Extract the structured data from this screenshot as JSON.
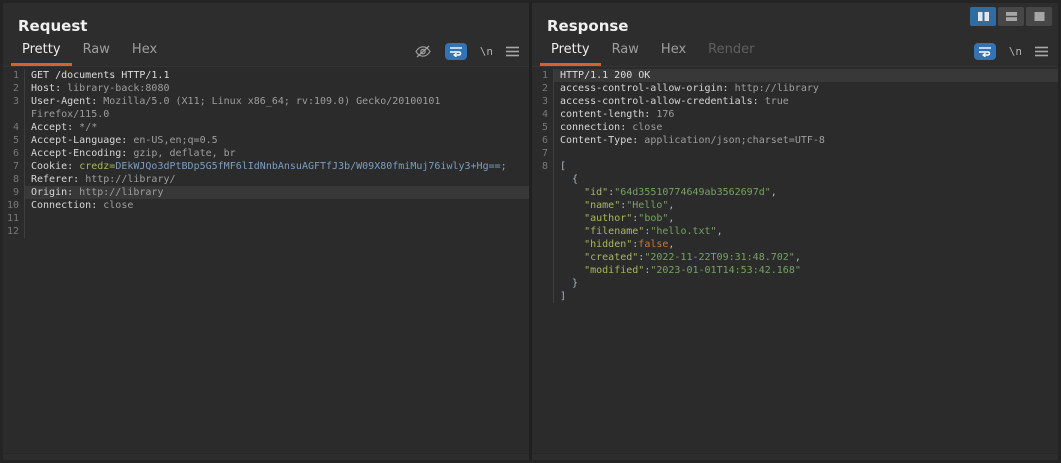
{
  "toolbar": {
    "layout_buttons": [
      {
        "name": "layout-side-by-side",
        "active": true
      },
      {
        "name": "layout-stacked",
        "active": false
      },
      {
        "name": "layout-single",
        "active": false
      }
    ],
    "active_color": "#2e6da4"
  },
  "accent_color": "#d8622b",
  "request": {
    "title": "Request",
    "tabs": [
      {
        "label": "Pretty",
        "state": "selected"
      },
      {
        "label": "Raw",
        "state": ""
      },
      {
        "label": "Hex",
        "state": ""
      }
    ],
    "icons": {
      "hide_icon": "hide-nonprintable-eye",
      "wrap_icon": "word-wrap",
      "newline_label": "\\n",
      "menu_icon": "menu"
    },
    "lines": [
      {
        "n": "1",
        "hl": false,
        "seg": [
          [
            "GET /documents HTTP/1.1",
            "plain"
          ]
        ]
      },
      {
        "n": "2",
        "hl": false,
        "seg": [
          [
            "Host:",
            "hname"
          ],
          [
            " library-back:8080",
            "hval"
          ]
        ]
      },
      {
        "n": "3",
        "hl": false,
        "seg": [
          [
            "User-Agent:",
            "hname"
          ],
          [
            " Mozilla/5.0 (X11; Linux x86_64; rv:109.0) Gecko/20100101",
            "hval"
          ]
        ]
      },
      {
        "n": "",
        "hl": false,
        "seg": [
          [
            "Firefox/115.0",
            "hval"
          ]
        ]
      },
      {
        "n": "4",
        "hl": false,
        "seg": [
          [
            "Accept:",
            "hname"
          ],
          [
            " */*",
            "hval"
          ]
        ]
      },
      {
        "n": "5",
        "hl": false,
        "seg": [
          [
            "Accept-Language:",
            "hname"
          ],
          [
            " en-US,en;q=0.5",
            "hval"
          ]
        ]
      },
      {
        "n": "6",
        "hl": false,
        "seg": [
          [
            "Accept-Encoding:",
            "hname"
          ],
          [
            " gzip, deflate, br",
            "hval"
          ]
        ]
      },
      {
        "n": "7",
        "hl": false,
        "seg": [
          [
            "Cookie:",
            "hname"
          ],
          [
            " ",
            "hval"
          ],
          [
            "credz=",
            "pname"
          ],
          [
            "DEkWJQo3dPtBDp5G5fMF6lIdNnbAnsuAGFTfJ3b/W09X80fmiMuj76iwly3+Hg==",
            "pval"
          ],
          [
            ";",
            "hval"
          ]
        ]
      },
      {
        "n": "8",
        "hl": false,
        "seg": [
          [
            "Referer:",
            "hname"
          ],
          [
            " http://library/",
            "hval"
          ]
        ]
      },
      {
        "n": "9",
        "hl": true,
        "seg": [
          [
            "Origin:",
            "hname"
          ],
          [
            " http://library",
            "hval"
          ]
        ]
      },
      {
        "n": "10",
        "hl": false,
        "seg": [
          [
            "Connection:",
            "hname"
          ],
          [
            " close",
            "hval"
          ]
        ]
      },
      {
        "n": "11",
        "hl": false,
        "seg": []
      },
      {
        "n": "12",
        "hl": false,
        "seg": []
      }
    ]
  },
  "response": {
    "title": "Response",
    "tabs": [
      {
        "label": "Pretty",
        "state": "selected"
      },
      {
        "label": "Raw",
        "state": ""
      },
      {
        "label": "Hex",
        "state": ""
      },
      {
        "label": "Render",
        "state": "disabled"
      }
    ],
    "icons": {
      "wrap_icon": "word-wrap",
      "newline_label": "\\n",
      "menu_icon": "menu"
    },
    "lines": [
      {
        "n": "1",
        "hl": true,
        "seg": [
          [
            "HTTP/1.1 200 OK",
            "plain"
          ]
        ]
      },
      {
        "n": "2",
        "hl": false,
        "seg": [
          [
            "access-control-allow-origin:",
            "hname"
          ],
          [
            " http://library",
            "hval"
          ]
        ]
      },
      {
        "n": "3",
        "hl": false,
        "seg": [
          [
            "access-control-allow-credentials:",
            "hname"
          ],
          [
            " true",
            "hval"
          ]
        ]
      },
      {
        "n": "4",
        "hl": false,
        "seg": [
          [
            "content-length:",
            "hname"
          ],
          [
            " 176",
            "hval"
          ]
        ]
      },
      {
        "n": "5",
        "hl": false,
        "seg": [
          [
            "connection:",
            "hname"
          ],
          [
            " close",
            "hval"
          ]
        ]
      },
      {
        "n": "6",
        "hl": false,
        "seg": [
          [
            "Content-Type:",
            "hname"
          ],
          [
            " application/json;charset=UTF-8",
            "hval"
          ]
        ]
      },
      {
        "n": "7",
        "hl": false,
        "seg": []
      },
      {
        "n": "8",
        "hl": false,
        "seg": [
          [
            "[",
            "punc"
          ]
        ]
      },
      {
        "n": "",
        "hl": false,
        "seg": [
          [
            "  {",
            "punc"
          ]
        ]
      },
      {
        "n": "",
        "hl": false,
        "seg": [
          [
            "    ",
            "punc"
          ],
          [
            "\"id\"",
            "jkey"
          ],
          [
            ":",
            "punc"
          ],
          [
            "\"64d35510774649ab3562697d\"",
            "jstr"
          ],
          [
            ",",
            "punc"
          ]
        ]
      },
      {
        "n": "",
        "hl": false,
        "seg": [
          [
            "    ",
            "punc"
          ],
          [
            "\"name\"",
            "jkey"
          ],
          [
            ":",
            "punc"
          ],
          [
            "\"Hello\"",
            "jstr"
          ],
          [
            ",",
            "punc"
          ]
        ]
      },
      {
        "n": "",
        "hl": false,
        "seg": [
          [
            "    ",
            "punc"
          ],
          [
            "\"author\"",
            "jkey"
          ],
          [
            ":",
            "punc"
          ],
          [
            "\"bob\"",
            "jstr"
          ],
          [
            ",",
            "punc"
          ]
        ]
      },
      {
        "n": "",
        "hl": false,
        "seg": [
          [
            "    ",
            "punc"
          ],
          [
            "\"filename\"",
            "jkey"
          ],
          [
            ":",
            "punc"
          ],
          [
            "\"hello.txt\"",
            "jstr"
          ],
          [
            ",",
            "punc"
          ]
        ]
      },
      {
        "n": "",
        "hl": false,
        "seg": [
          [
            "    ",
            "punc"
          ],
          [
            "\"hidden\"",
            "jkey"
          ],
          [
            ":",
            "punc"
          ],
          [
            "false",
            "jbool"
          ],
          [
            ",",
            "punc"
          ]
        ]
      },
      {
        "n": "",
        "hl": false,
        "seg": [
          [
            "    ",
            "punc"
          ],
          [
            "\"created\"",
            "jkey"
          ],
          [
            ":",
            "punc"
          ],
          [
            "\"2022-11-22T09:31:48.702\"",
            "jstr"
          ],
          [
            ",",
            "punc"
          ]
        ]
      },
      {
        "n": "",
        "hl": false,
        "seg": [
          [
            "    ",
            "punc"
          ],
          [
            "\"modified\"",
            "jkey"
          ],
          [
            ":",
            "punc"
          ],
          [
            "\"2023-01-01T14:53:42.168\"",
            "jstr"
          ]
        ]
      },
      {
        "n": "",
        "hl": false,
        "seg": [
          [
            "  }",
            "punc"
          ]
        ]
      },
      {
        "n": "",
        "hl": false,
        "seg": [
          [
            "]",
            "punc"
          ]
        ]
      }
    ]
  },
  "colors": {
    "background": "#2d2d2d",
    "editor_background": "#2b2b2b",
    "selected_line": "#383838",
    "tab_underline": "#d8622b",
    "header_name": "#d6d6d6",
    "header_value": "#9e9e9e",
    "cookie_name": "#a9b75d",
    "cookie_value": "#7a9ec2",
    "json_key": "#a9b75d",
    "json_string": "#74a263",
    "json_boolean": "#cc7832",
    "wrap_button_blue": "#3173b4"
  }
}
